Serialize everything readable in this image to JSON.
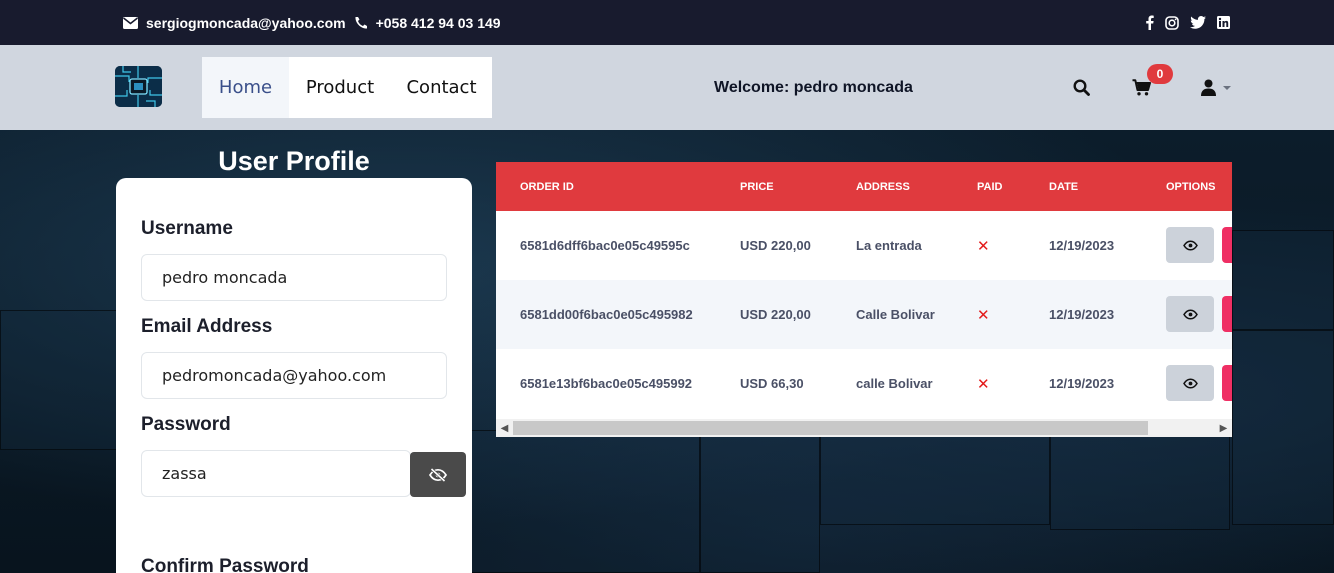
{
  "topbar": {
    "email": "sergiogmoncada@yahoo.com",
    "phone": "+058 412 94 03 149",
    "social_icons": [
      "facebook-icon",
      "instagram-icon",
      "twitter-icon",
      "linkedin-icon"
    ]
  },
  "navbar": {
    "links": [
      {
        "label": "Home",
        "active": true
      },
      {
        "label": "Product",
        "active": false
      },
      {
        "label": "Contact",
        "active": false
      }
    ],
    "welcome": "Welcome: pedro moncada",
    "cart_count": "0",
    "icons": [
      "search-icon",
      "cart-icon",
      "user-icon",
      "caret-down-icon"
    ]
  },
  "profile": {
    "title": "User Profile",
    "username_label": "Username",
    "username_value": "pedro moncada",
    "email_label": "Email Address",
    "email_value": "pedromoncada@yahoo.com",
    "password_label": "Password",
    "password_value": "zassa",
    "confirm_label": "Confirm Password"
  },
  "orders": {
    "headers": [
      "ORDER ID",
      "PRICE",
      "ADDRESS",
      "PAID",
      "DATE",
      "OPTIONS"
    ],
    "rows": [
      {
        "id": "6581d6dff6bac0e05c49595c",
        "price": "USD 220,00",
        "address": "La entrada",
        "paid": "✕",
        "date": "12/19/2023"
      },
      {
        "id": "6581dd00f6bac0e05c495982",
        "price": "USD 220,00",
        "address": "Calle Bolivar",
        "paid": "✕",
        "date": "12/19/2023"
      },
      {
        "id": "6581e13bf6bac0e05c495992",
        "price": "USD 66,30",
        "address": "calle Bolivar",
        "paid": "✕",
        "date": "12/19/2023"
      }
    ]
  },
  "colors": {
    "topbar": "#181b2e",
    "navbar": "#d0d6df",
    "table_header": "#e03a3e",
    "delete_button": "#ef2f64",
    "paid_no": "#e31b1b"
  }
}
